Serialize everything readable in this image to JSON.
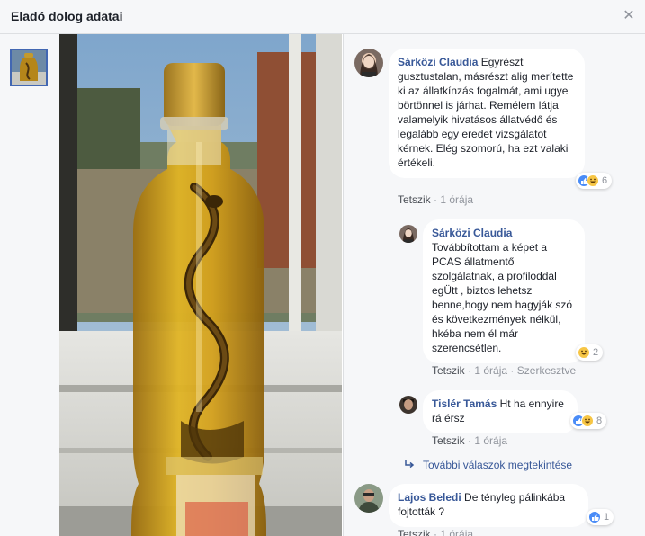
{
  "header": {
    "title": "Eladó dolog adatai",
    "close_icon": "close-icon"
  },
  "comments": [
    {
      "author": "Sárközi Claudia",
      "text": "Egyrészt gusztustalan, másrészt alig merítette ki az állatkínzás fogalmát, ami ugye börtönnel is járhat. Remélem látja valamelyik hivatásos állatvédő és legalább egy eredet vizsgálatot kérnek. Elég szomorú, ha ezt valaki értékeli.",
      "like": "Tetszik",
      "time": "1 órája",
      "reaction_count": "6",
      "reactions": [
        "like",
        "haha"
      ]
    }
  ],
  "replies": [
    {
      "author": "Sárközi Claudia",
      "text": "Továbbítottam a képet a PCAS állatmentő szolgálatnak, a profiloddal egÜtt , biztos lehetsz benne,hogy nem hagyják szó és következmények nélkül, hkéba nem él már szerencsétlen.",
      "like": "Tetszik",
      "time": "1 órája",
      "edited": "Szerkesztve",
      "reaction_count": "2",
      "reactions": [
        "haha"
      ]
    },
    {
      "author": "Tislér Tamás",
      "text": "Ht ha ennyire rá érsz",
      "like": "Tetszik",
      "time": "1 órája",
      "reaction_count": "8",
      "reactions": [
        "like",
        "haha"
      ]
    }
  ],
  "more_replies": "További válaszok megtekintése",
  "last_comment": {
    "author": "Lajos Beledi",
    "text": "De tényleg pálinkába fojtották ?",
    "like": "Tetszik",
    "time": "1 órája",
    "reaction_count": "1",
    "reactions": [
      "like"
    ]
  },
  "separator": "·",
  "colors": {
    "link": "#385898",
    "accent": "#4267b2",
    "panel": "#f6f7f9"
  }
}
